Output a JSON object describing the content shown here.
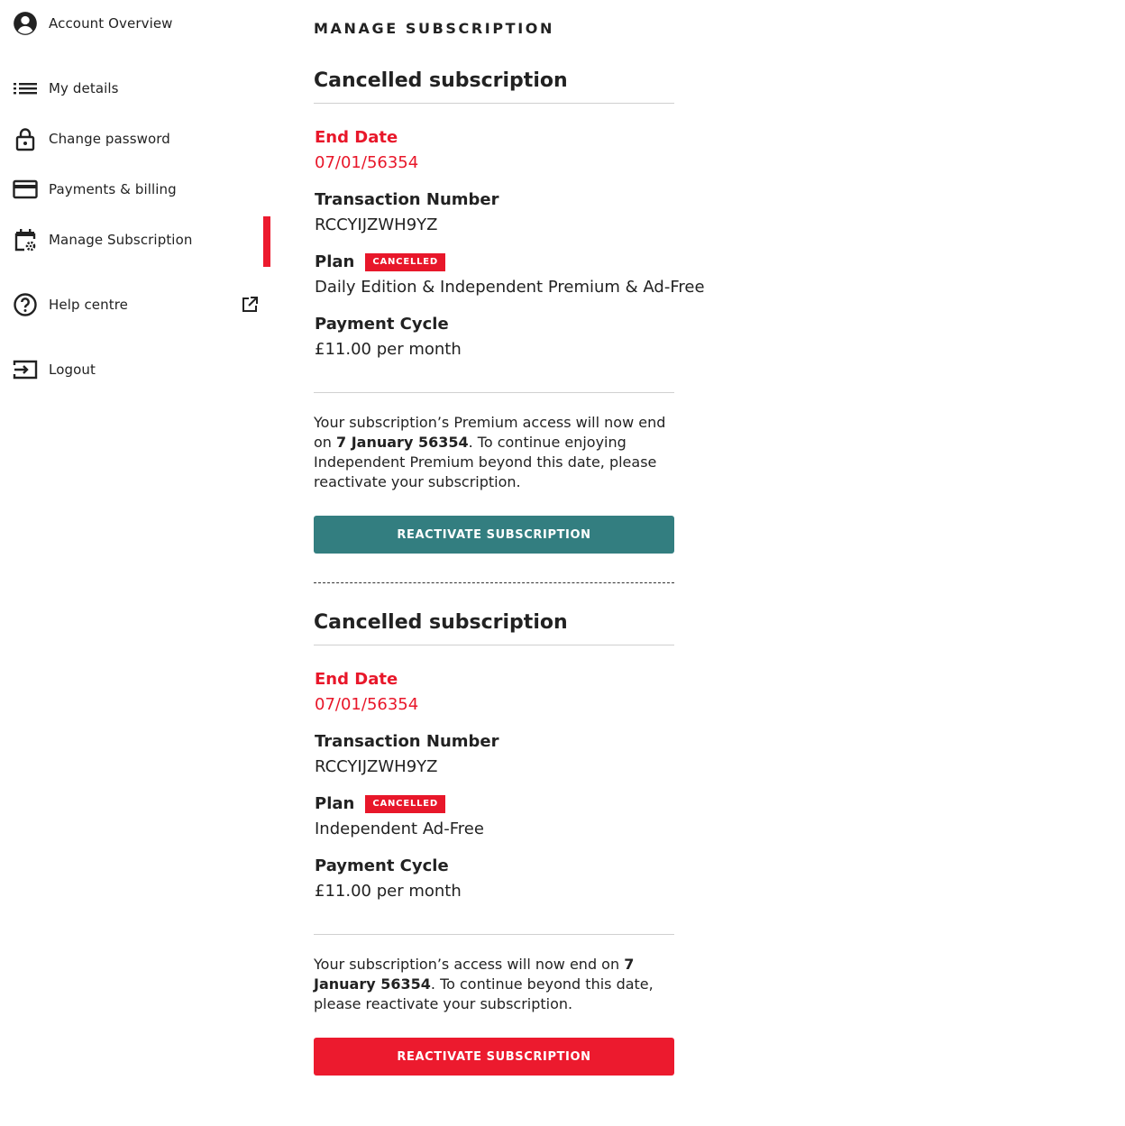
{
  "sidebar": {
    "items": [
      {
        "label": "Account Overview",
        "icon": "account-circle-icon"
      },
      {
        "label": "My details",
        "icon": "list-icon"
      },
      {
        "label": "Change password",
        "icon": "lock-icon"
      },
      {
        "label": "Payments & billing",
        "icon": "credit-card-icon"
      },
      {
        "label": "Manage Subscription",
        "icon": "calendar-settings-icon",
        "active": true
      },
      {
        "label": "Help centre",
        "icon": "help-circle-icon",
        "external_icon": "external-link-icon"
      },
      {
        "label": "Logout",
        "icon": "logout-icon"
      }
    ]
  },
  "main": {
    "title": "MANAGE SUBSCRIPTION",
    "subscriptions": [
      {
        "heading": "Cancelled subscription",
        "end_date_label": "End Date",
        "end_date": "07/01/56354",
        "transaction_label": "Transaction Number",
        "transaction_number": "RCCYIJZWH9YZ",
        "plan_label": "Plan",
        "plan_badge": "CANCELLED",
        "plan_name": "Daily Edition & Independent Premium & Ad-Free",
        "cycle_label": "Payment Cycle",
        "cycle_value": "£11.00 per month",
        "note_pre": "Your subscription’s Premium access will now end on ",
        "note_date": "7 January 56354",
        "note_post": ". To continue enjoying Independent Premium beyond this date, please reactivate your subscription.",
        "button_label": "REACTIVATE SUBSCRIPTION"
      },
      {
        "heading": "Cancelled subscription",
        "end_date_label": "End Date",
        "end_date": "07/01/56354",
        "transaction_label": "Transaction Number",
        "transaction_number": "RCCYIJZWH9YZ",
        "plan_label": "Plan",
        "plan_badge": "CANCELLED",
        "plan_name": "Independent Ad-Free",
        "cycle_label": "Payment Cycle",
        "cycle_value": "£11.00 per month",
        "note_pre": "Your subscription’s access will now end on ",
        "note_date": "7 January 56354",
        "note_post": ". To continue beyond this date, please reactivate your subscription.",
        "button_label": "REACTIVATE SUBSCRIPTION"
      }
    ]
  },
  "colors": {
    "accent_red": "#e8172a",
    "teal_button": "#337e80",
    "active_indicator": "#ec1a2e"
  }
}
